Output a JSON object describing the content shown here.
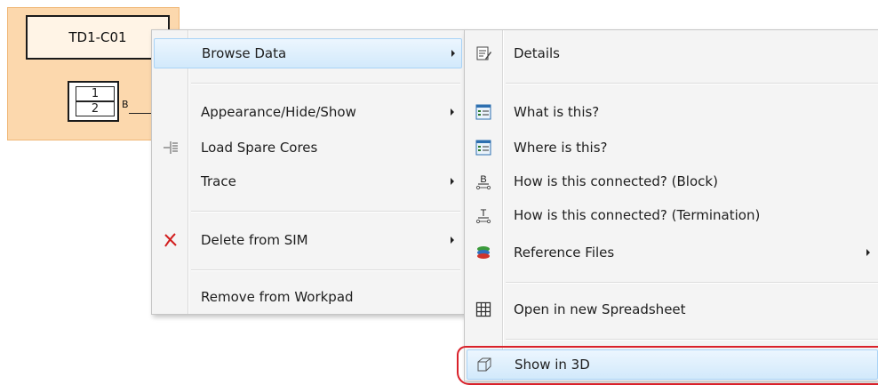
{
  "block": {
    "title": "TD1-C01",
    "port_top": "1",
    "port_bottom": "2",
    "port_label": "B"
  },
  "context_menu": {
    "items": [
      {
        "label": "Browse Data",
        "icon": "none",
        "submenu": true,
        "highlighted": true
      },
      {
        "label": "Appearance/Hide/Show",
        "icon": "none",
        "submenu": true
      },
      {
        "label": "Load Spare Cores",
        "icon": "load-spare-cores-icon",
        "submenu": false
      },
      {
        "label": "Trace",
        "icon": "none",
        "submenu": true
      },
      {
        "label": "Delete from SIM",
        "icon": "red-x-icon",
        "submenu": true
      },
      {
        "label": "Remove from Workpad",
        "icon": "none",
        "submenu": false
      }
    ]
  },
  "submenu": {
    "items": [
      {
        "label": "Details",
        "icon": "details-icon"
      },
      {
        "label": "What is this?",
        "icon": "properties-icon"
      },
      {
        "label": "Where is this?",
        "icon": "properties-icon"
      },
      {
        "label": "How is this connected? (Block)",
        "icon": "block-connection-icon",
        "glyph": "B"
      },
      {
        "label": "How is this connected? (Termination)",
        "icon": "termination-connection-icon",
        "glyph": "T"
      },
      {
        "label": "Reference Files",
        "icon": "reference-files-icon",
        "submenu": true
      },
      {
        "label": "Open in new Spreadsheet",
        "icon": "spreadsheet-grid-icon"
      },
      {
        "label": "Show in 3D",
        "icon": "cube-3d-icon",
        "highlighted": true
      }
    ]
  },
  "colors": {
    "block_fill": "#fcd8ad",
    "highlight": "#d2e9fb",
    "annotation_red": "#d9212a"
  }
}
